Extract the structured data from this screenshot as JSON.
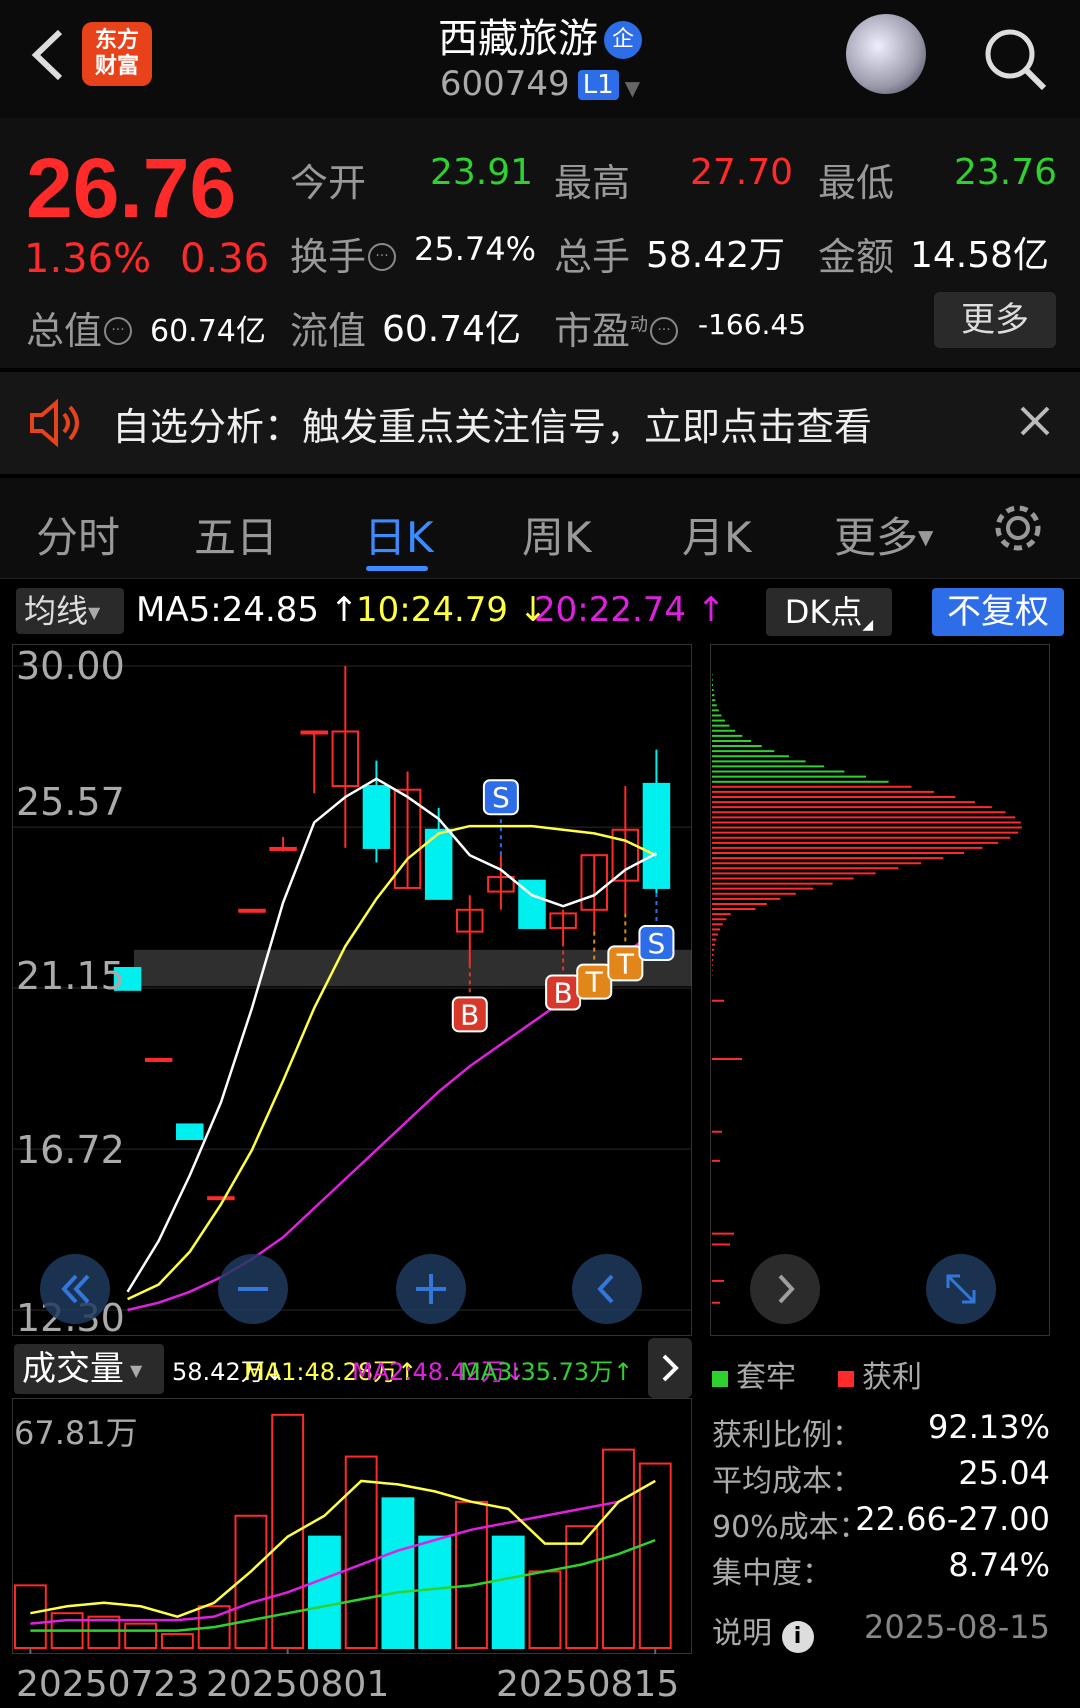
{
  "header": {
    "app_logo": "东方\n财富",
    "stock_name": "西藏旅游",
    "badge": "企",
    "stock_code": "600749",
    "level": "L1"
  },
  "quote": {
    "price": "26.76",
    "change_pct": "1.36%",
    "change": "0.36",
    "open_label": "今开",
    "open": "23.91",
    "high_label": "最高",
    "high": "27.70",
    "low_label": "最低",
    "low": "23.76",
    "turnover_label": "换手",
    "turnover": "25.74%",
    "volume_label": "总手",
    "volume": "58.42万",
    "amount_label": "金额",
    "amount": "14.58亿",
    "mktcap_label": "总值",
    "mktcap": "60.74亿",
    "float_label": "流值",
    "float_cap": "60.74亿",
    "pe_label": "市盈",
    "pe_sup": "动",
    "pe": "-166.45",
    "more_label": "更多"
  },
  "alert": {
    "text": "自选分析：触发重点关注信号，立即点击查看"
  },
  "tabs": [
    "分时",
    "五日",
    "日K",
    "周K",
    "月K",
    "更多"
  ],
  "active_tab": 2,
  "ma_row": {
    "selector": "均线",
    "ma5": "MA5:24.85",
    "ma10": "10:24.79",
    "ma20": "20:22.74",
    "dk": "DK点",
    "adjust": "不复权"
  },
  "colors": {
    "up": "#ff2a2a",
    "down": "#00f0f0",
    "ma5": "#ffffff",
    "ma10": "#ffff44",
    "ma20": "#e020e0",
    "accent": "#2d6ee8"
  },
  "chart_data": {
    "type": "candlestick",
    "y_ticks": [
      "30.00",
      "25.57",
      "21.15",
      "16.72",
      "12.30"
    ],
    "ylim": [
      12.3,
      30.0
    ],
    "candles": [
      {
        "o": 21.7,
        "c": 21.1,
        "h": 21.7,
        "l": 21.1
      },
      {
        "o": 19.2,
        "c": 19.2,
        "h": 19.2,
        "l": 19.2
      },
      {
        "o": 17.4,
        "c": 17.0,
        "h": 17.4,
        "l": 17.0
      },
      {
        "o": 15.4,
        "c": 15.4,
        "h": 15.4,
        "l": 15.4
      },
      {
        "o": 23.3,
        "c": 23.3,
        "h": 23.3,
        "l": 23.3
      },
      {
        "o": 25.0,
        "c": 25.0,
        "h": 25.3,
        "l": 24.9
      },
      {
        "o": 28.2,
        "c": 28.2,
        "h": 28.2,
        "l": 26.5
      },
      {
        "o": 26.7,
        "c": 28.2,
        "h": 30.0,
        "l": 25.0
      },
      {
        "o": 26.7,
        "c": 25.0,
        "h": 27.4,
        "l": 24.6
      },
      {
        "o": 23.9,
        "c": 26.6,
        "h": 27.1,
        "l": 23.9
      },
      {
        "o": 25.5,
        "c": 23.6,
        "h": 26.1,
        "l": 23.6
      },
      {
        "o": 22.7,
        "c": 23.3,
        "h": 23.7,
        "l": 21.8
      },
      {
        "o": 23.8,
        "c": 24.2,
        "h": 24.8,
        "l": 23.3
      },
      {
        "o": 24.1,
        "c": 22.8,
        "h": 24.1,
        "l": 22.8
      },
      {
        "o": 22.8,
        "c": 23.2,
        "h": 23.3,
        "l": 22.4
      },
      {
        "o": 23.3,
        "c": 24.8,
        "h": 24.8,
        "l": 22.7
      },
      {
        "o": 24.1,
        "c": 25.5,
        "h": 26.7,
        "l": 23.2
      },
      {
        "o": 26.76,
        "c": 23.9,
        "h": 27.7,
        "l": 23.76
      }
    ],
    "ma5": [
      12.8,
      14.2,
      16.0,
      18.0,
      20.6,
      23.5,
      25.7,
      26.4,
      26.9,
      26.4,
      25.8,
      24.8,
      24.4,
      23.7,
      23.4,
      23.7,
      24.4,
      24.85
    ],
    "ma10": [
      12.6,
      13.0,
      13.9,
      15.2,
      16.7,
      18.6,
      20.6,
      22.3,
      23.6,
      24.7,
      25.4,
      25.6,
      25.6,
      25.6,
      25.5,
      25.4,
      25.2,
      24.79
    ],
    "ma20": [
      12.3,
      12.5,
      12.8,
      13.2,
      13.7,
      14.3,
      15.1,
      15.9,
      16.7,
      17.5,
      18.3,
      19.0,
      19.6,
      20.2,
      20.8,
      21.4,
      22.1,
      22.74
    ],
    "signals": [
      {
        "label": "S",
        "index": 12,
        "pos": "above"
      },
      {
        "label": "B",
        "index": 11,
        "pos": "below"
      },
      {
        "label": "B",
        "index": 14,
        "pos": "below"
      },
      {
        "label": "T",
        "index": 15,
        "pos": "below"
      },
      {
        "label": "T",
        "index": 16,
        "pos": "below"
      },
      {
        "label": "S",
        "index": 17,
        "pos": "below"
      }
    ]
  },
  "volume": {
    "selector": "成交量",
    "current": "58.42万↓",
    "ma1": "MA1:48.28万↑",
    "ma2": "MA2:48.42万↓",
    "ma3": "MA3:35.73万↑",
    "max_label": "67.81万",
    "max": 67.81,
    "bars": [
      {
        "v": 18,
        "up": true
      },
      {
        "v": 10,
        "up": true
      },
      {
        "v": 9,
        "up": true
      },
      {
        "v": 7,
        "up": true
      },
      {
        "v": 4,
        "up": true
      },
      {
        "v": 12,
        "up": true
      },
      {
        "v": 38,
        "up": true
      },
      {
        "v": 67,
        "up": true
      },
      {
        "v": 32,
        "up": false
      },
      {
        "v": 55,
        "up": true
      },
      {
        "v": 43,
        "up": false
      },
      {
        "v": 32,
        "up": false
      },
      {
        "v": 42,
        "up": true
      },
      {
        "v": 32,
        "up": false
      },
      {
        "v": 22,
        "up": true
      },
      {
        "v": 35,
        "up": true
      },
      {
        "v": 57,
        "up": true
      },
      {
        "v": 53,
        "up": true
      }
    ],
    "ma_yellow": [
      10,
      12,
      13,
      12,
      9,
      13,
      22,
      32,
      38,
      48,
      47,
      45,
      42,
      40,
      30,
      30,
      42,
      48
    ],
    "ma_magenta": [
      7,
      8,
      8,
      8,
      8,
      9,
      13,
      16,
      20,
      24,
      28,
      31,
      34,
      36,
      38,
      40,
      42,
      48
    ],
    "ma_green": [
      5,
      5,
      5,
      5,
      5,
      6,
      8,
      10,
      12,
      14,
      16,
      17,
      18,
      20,
      22,
      24,
      27,
      31
    ],
    "dates": [
      "20250723",
      "20250801",
      "20250815"
    ]
  },
  "chip": {
    "legend_loss": "套牢",
    "legend_profit": "获利",
    "rows": [
      {
        "label": "获利比例：",
        "value": "92.13%"
      },
      {
        "label": "平均成本：",
        "value": "25.04"
      },
      {
        "label": "90%成本：",
        "value": "22.66-27.00"
      },
      {
        "label": "集中度：",
        "value": "8.74%"
      }
    ],
    "note_label": "说明",
    "date": "2025-08-15"
  }
}
